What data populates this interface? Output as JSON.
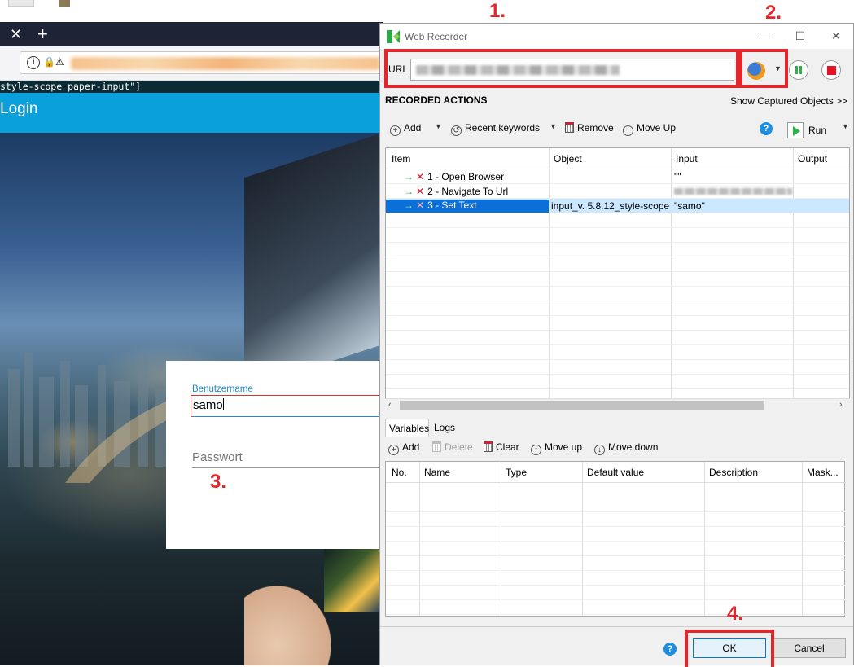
{
  "browser": {
    "dev_selector_text": "style-scope paper-input\"]",
    "login_header": "Login",
    "login_form": {
      "username_label": "Benutzername",
      "username_value": "samo",
      "password_placeholder": "Passwort"
    }
  },
  "annotations": [
    "1.",
    "2.",
    "3.",
    "4."
  ],
  "recorder": {
    "window_title": "Web Recorder",
    "url_label": "URL",
    "section_title": "RECORDED ACTIONS",
    "show_captured": "Show Captured Objects >>",
    "toolbar": {
      "add": "Add",
      "recent_keywords": "Recent keywords",
      "remove": "Remove",
      "move_up": "Move Up",
      "run": "Run"
    },
    "actions_table": {
      "headers": [
        "Item",
        "Object",
        "Input",
        "Output"
      ],
      "rows": [
        {
          "item": "1 - Open Browser",
          "object": "",
          "input": "\"\"",
          "output": ""
        },
        {
          "item": "2 - Navigate To Url",
          "object": "",
          "input": "",
          "output": ""
        },
        {
          "item": "3 - Set Text",
          "object": "input_v. 5.8.12_style-scope",
          "input": "\"samo\"",
          "output": ""
        }
      ],
      "selected_row": 3
    },
    "bottom_tabs": [
      "Variables",
      "Logs"
    ],
    "variables_toolbar": {
      "add": "Add",
      "delete": "Delete",
      "clear": "Clear",
      "move_up": "Move up",
      "move_down": "Move down"
    },
    "variables_table": {
      "headers": [
        "No.",
        "Name",
        "Type",
        "Default value",
        "Description",
        "Mask..."
      ]
    },
    "buttons": {
      "ok": "OK",
      "cancel": "Cancel"
    }
  },
  "colors": {
    "annotation_red": "#e2262b",
    "login_blue": "#0aa0dc",
    "selection_blue": "#0a6fd8",
    "selection_light": "#cce8ff"
  }
}
